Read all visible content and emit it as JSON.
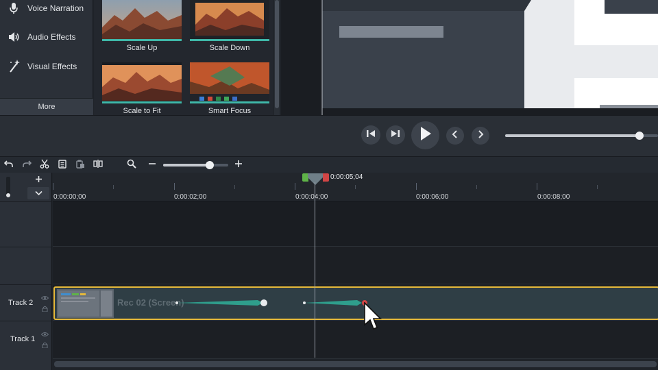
{
  "sidebar": {
    "items": [
      {
        "label": "Voice Narration",
        "icon": "microphone-icon"
      },
      {
        "label": "Audio Effects",
        "icon": "speaker-icon"
      },
      {
        "label": "Visual Effects",
        "icon": "magic-wand-icon"
      }
    ],
    "more_label": "More"
  },
  "effects": [
    {
      "label": "Scale Up"
    },
    {
      "label": "Scale Down"
    },
    {
      "label": "Scale to Fit"
    },
    {
      "label": "Smart Focus"
    }
  ],
  "player": {
    "progress": 0.88
  },
  "toolbar": {
    "zoom_level": 0.72
  },
  "timeline": {
    "playhead_time": "0:00:05;04",
    "ticks": [
      "0:00:00;00",
      "0:00:02;00",
      "0:00:04;00",
      "0:00:06;00",
      "0:00:08;00"
    ],
    "tracks": [
      {
        "name": "Track 2"
      },
      {
        "name": "Track 1"
      }
    ],
    "clip_label": "Rec 02 (Screen)"
  },
  "colors": {
    "accent_teal": "#3fb8a9",
    "clip_border": "#e6b93a",
    "animation_arrow": "#2f9e8c",
    "playhead_green": "#5fb348",
    "playhead_red": "#d04545"
  }
}
